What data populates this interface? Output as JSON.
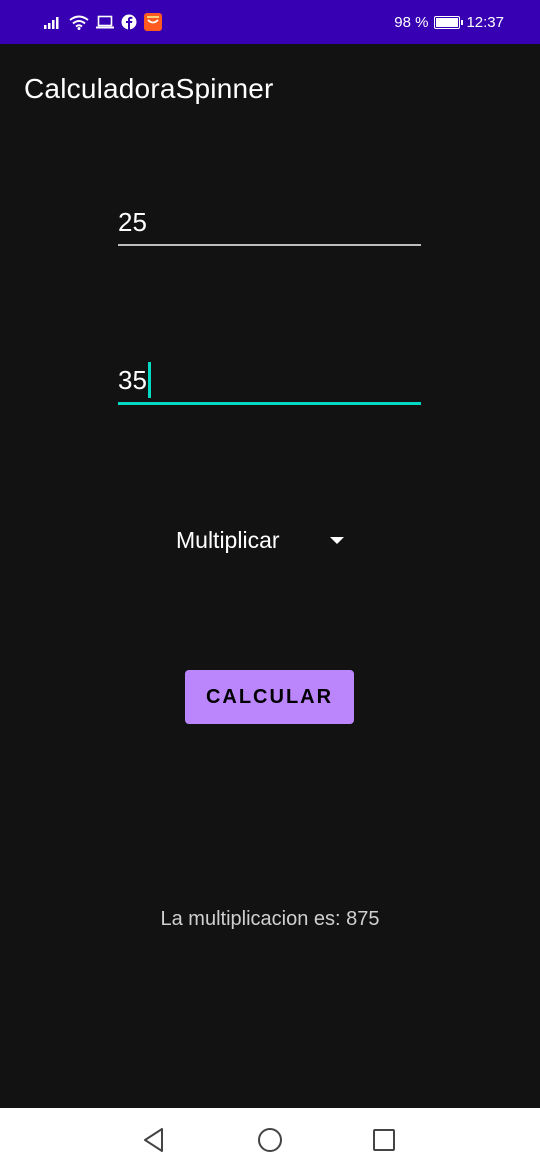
{
  "status_bar": {
    "battery_percent": "98 %",
    "battery_level": 0.98,
    "time": "12:37",
    "icons": [
      "signal-icon",
      "wifi-icon",
      "laptop-icon",
      "facebook-icon",
      "shop-icon",
      "battery-icon"
    ]
  },
  "app_bar": {
    "title": "CalculadoraSpinner"
  },
  "inputs": {
    "first_value": "25",
    "second_value": "35"
  },
  "spinner": {
    "selected": "Multiplicar"
  },
  "button": {
    "label": "CALCULAR"
  },
  "result": {
    "text": "La multiplicacion es: 875"
  },
  "nav_bar": {
    "icons": [
      "back-icon",
      "home-icon",
      "recents-icon"
    ]
  },
  "colors": {
    "status_bar": "#3700b3",
    "background": "#121212",
    "accent": "#03dac5",
    "button": "#bb86fc"
  }
}
